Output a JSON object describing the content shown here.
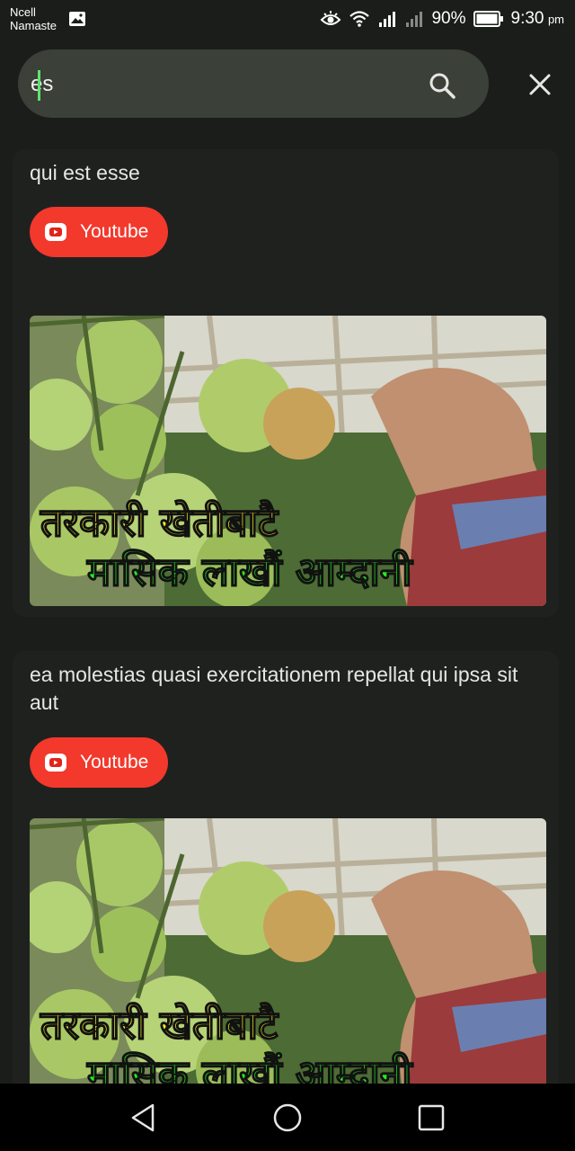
{
  "status_bar": {
    "carrier_line1": "Ncell",
    "carrier_line2": "Namaste",
    "battery_percent": "90%",
    "time": "9:30",
    "ampm": "pm",
    "icons": [
      "gallery-icon",
      "eye-icon",
      "wifi-icon",
      "signal-icon",
      "signal-weak-icon",
      "battery-icon"
    ]
  },
  "search": {
    "value": "es",
    "placeholder": ""
  },
  "results": [
    {
      "title": "qui est esse",
      "source_label": "Youtube",
      "thumbnail_caption_line1": "तरकारी खेतीबाटै",
      "thumbnail_caption_line2": "मासिक लाखौं आम्दानी"
    },
    {
      "title": "ea molestias quasi exercitationem repellat qui ipsa sit aut",
      "source_label": "Youtube",
      "thumbnail_caption_line1": "तरकारी खेतीबाटै",
      "thumbnail_caption_line2": "मासिक लाखौं आम्दानी"
    }
  ],
  "colors": {
    "background": "#1b1d1b",
    "search_bg": "#3b4038",
    "chip_red": "#f2392c",
    "caret_green": "#5ee26e"
  },
  "nav": [
    "back-icon",
    "home-icon",
    "recents-icon"
  ]
}
